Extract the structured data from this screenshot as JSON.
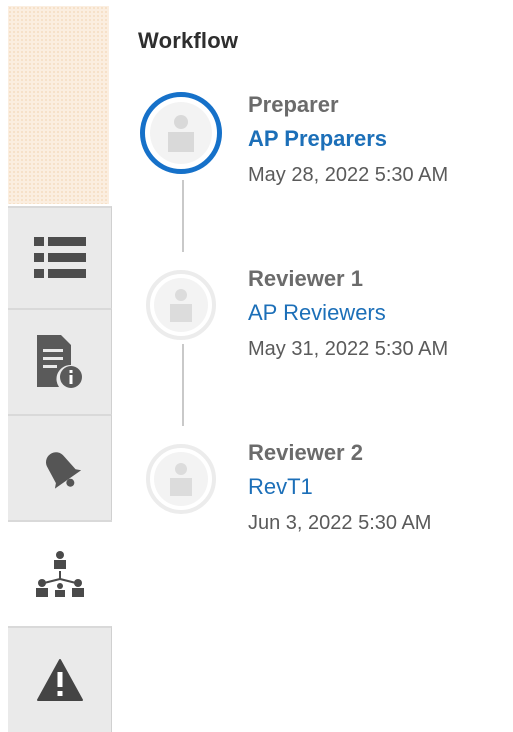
{
  "rail": {
    "tabs": [
      {
        "icon": "list-icon",
        "active": false
      },
      {
        "icon": "document-info-icon",
        "active": false
      },
      {
        "icon": "bell-icon",
        "active": false
      },
      {
        "icon": "workflow-hierarchy-icon",
        "active": true
      },
      {
        "icon": "warning-icon",
        "active": false
      }
    ]
  },
  "panel": {
    "title": "Workflow"
  },
  "workflow": {
    "steps": [
      {
        "role": "Preparer",
        "assignee": "AP Preparers",
        "date": "May 28, 2022 5:30 AM",
        "current": true
      },
      {
        "role": "Reviewer 1",
        "assignee": "AP Reviewers",
        "date": "May 31, 2022 5:30 AM",
        "current": false
      },
      {
        "role": "Reviewer 2",
        "assignee": "RevT1",
        "date": "Jun 3, 2022 5:30 AM",
        "current": false
      }
    ]
  },
  "colors": {
    "accent": "#1671c9",
    "link": "#1c6fb8",
    "rail_background": "#eaeaea",
    "top_pattern": "#fbeee0"
  }
}
